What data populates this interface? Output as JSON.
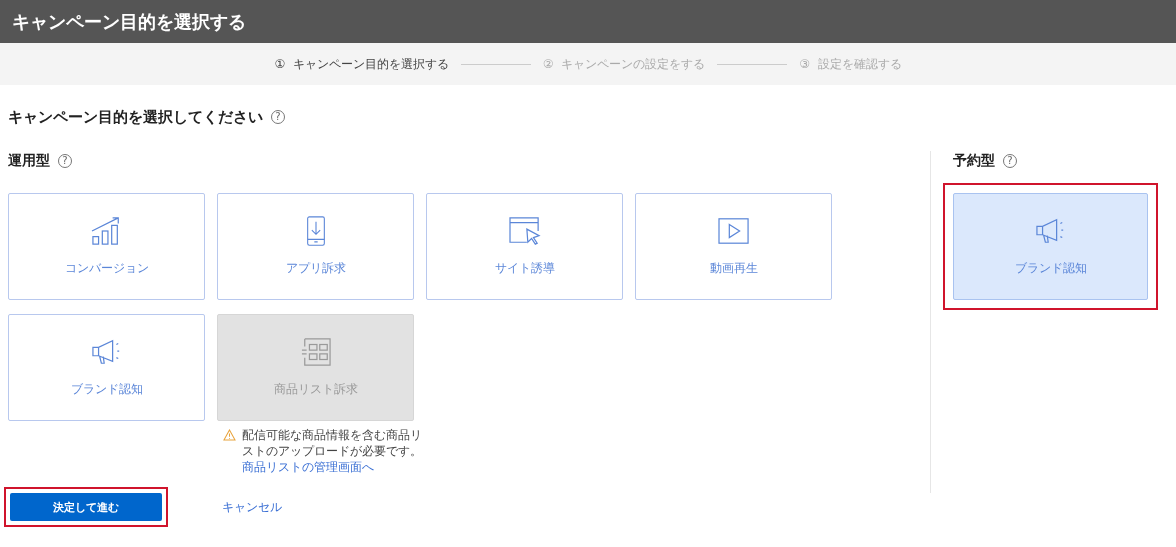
{
  "header": {
    "title": "キャンペーン目的を選択する"
  },
  "steps": [
    {
      "number": "①",
      "label": "キャンペーン目的を選択する",
      "selected": true
    },
    {
      "number": "②",
      "label": "キャンペーンの設定をする",
      "selected": false
    },
    {
      "number": "③",
      "label": "設定を確認する",
      "selected": false
    }
  ],
  "heading": {
    "text": "キャンペーン目的を選択してください",
    "help": "?"
  },
  "operational": {
    "title": "運用型",
    "help": "?",
    "cards": [
      {
        "kind": "conversion",
        "label": "コンバージョン",
        "disabled": false,
        "selected": false
      },
      {
        "kind": "app",
        "label": "アプリ訴求",
        "disabled": false,
        "selected": false
      },
      {
        "kind": "site",
        "label": "サイト誘導",
        "disabled": false,
        "selected": false
      },
      {
        "kind": "video",
        "label": "動画再生",
        "disabled": false,
        "selected": false
      },
      {
        "kind": "brand",
        "label": "ブランド認知",
        "disabled": false,
        "selected": false
      },
      {
        "kind": "product",
        "label": "商品リスト訴求",
        "disabled": true,
        "selected": false
      }
    ]
  },
  "warning": {
    "text": "配信可能な商品情報を含む商品リストのアップロードが必要です。",
    "link": "商品リストの管理画面へ"
  },
  "reserved": {
    "title": "予約型",
    "help": "?",
    "cards": [
      {
        "kind": "brand",
        "label": "ブランド認知",
        "disabled": false,
        "selected": true,
        "highlighted": true
      }
    ]
  },
  "actions": {
    "submit": {
      "label": "決定して進む",
      "highlighted": true
    },
    "cancel": "キャンセル"
  }
}
